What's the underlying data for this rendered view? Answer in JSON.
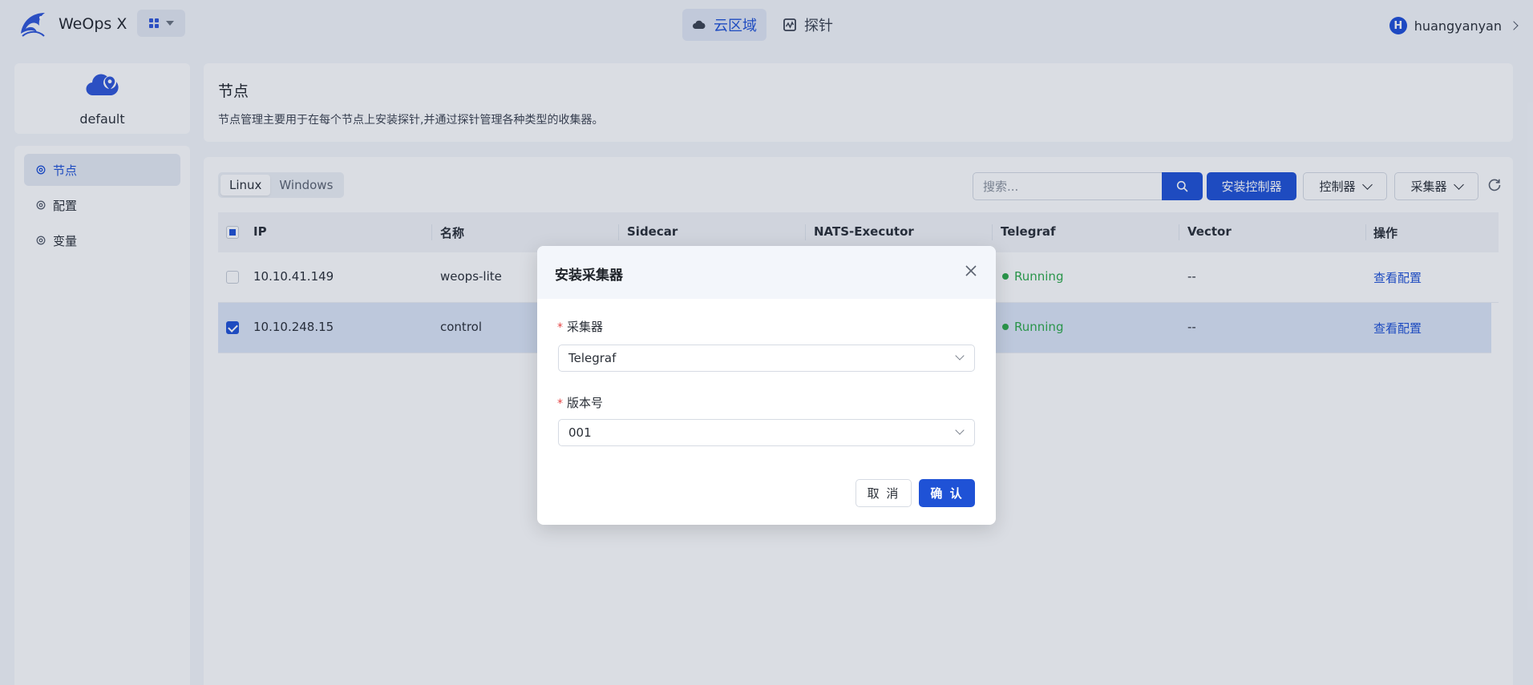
{
  "app": {
    "title": "WeOps X"
  },
  "topnav": {
    "items": [
      {
        "label": "云区域",
        "icon": "cloud-icon",
        "active": true
      },
      {
        "label": "探针",
        "icon": "probe-icon",
        "active": false
      }
    ]
  },
  "user": {
    "initial": "H",
    "name": "huangyanyan"
  },
  "cloud": {
    "name": "default"
  },
  "sidebar": {
    "items": [
      {
        "label": "节点",
        "active": true
      },
      {
        "label": "配置",
        "active": false
      },
      {
        "label": "变量",
        "active": false
      }
    ]
  },
  "header": {
    "title": "节点",
    "description": "节点管理主要用于在每个节点上安装探针,并通过探针管理各种类型的收集器。"
  },
  "toolbar": {
    "os_tabs": [
      {
        "label": "Linux",
        "active": true
      },
      {
        "label": "Windows",
        "active": false
      }
    ],
    "search_placeholder": "搜索...",
    "install_controller_label": "安装控制器",
    "controller_dropdown_label": "控制器",
    "collector_dropdown_label": "采集器"
  },
  "table": {
    "columns": [
      "IP",
      "名称",
      "Sidecar",
      "NATS-Executor",
      "Telegraf",
      "Vector",
      "操作"
    ],
    "rows": [
      {
        "ip": "10.10.41.149",
        "name": "weops-lite",
        "telegraf": "Running",
        "vector": "--",
        "action": "查看配置",
        "checked": false
      },
      {
        "ip": "10.10.248.15",
        "name": "control",
        "telegraf": "Running",
        "vector": "--",
        "action": "查看配置",
        "checked": true
      }
    ]
  },
  "modal": {
    "title": "安装采集器",
    "collector_label": "采集器",
    "collector_value": "Telegraf",
    "version_label": "版本号",
    "version_value": "001",
    "required_mark": "*",
    "cancel_label": "取 消",
    "ok_label": "确 认"
  },
  "colors": {
    "primary": "#1f52d6",
    "running": "#2eaa4a",
    "required": "#e54545"
  }
}
